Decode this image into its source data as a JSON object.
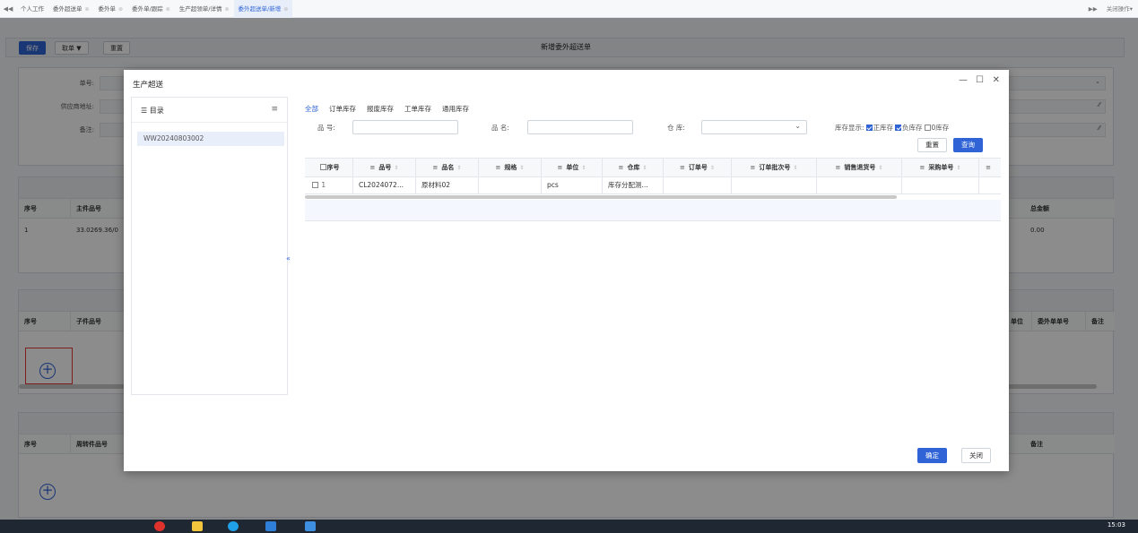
{
  "tabs": {
    "items": [
      "个人工作",
      "委外超送单",
      "委外单",
      "委外单/跟踪",
      "生产超领单/详情",
      "委外超送单/新增"
    ],
    "active_index": 5,
    "close_all_label": "关闭操作"
  },
  "toolbar": {
    "save_label": "保存",
    "fetch_label": "取单 ▼",
    "reset_label": "重置",
    "page_title": "新增委外超送单"
  },
  "form": {
    "order_no_label": "单号:",
    "supplier_address_label": "供应商地址:",
    "remark_label": "备注:"
  },
  "main_table": {
    "headers": [
      "序号",
      "主件品号",
      "总金额"
    ],
    "row": {
      "index": "1",
      "item_no": "33.0269.36/0",
      "amount": "0.00"
    }
  },
  "sub_table": {
    "headers": [
      "序号",
      "子件品号",
      "单位",
      "委外单单号",
      "备注"
    ]
  },
  "bottom_table": {
    "headers": [
      "序号",
      "周转件品号",
      "备注"
    ]
  },
  "taskbar": {
    "time": "15:03"
  },
  "dialog": {
    "title": "生产超送",
    "tree_title": "目录",
    "tree_item": "WW20240803002",
    "tabs": [
      "全部",
      "订单库存",
      "报废库存",
      "工单库存",
      "通用库存"
    ],
    "active_tab": 0,
    "search": {
      "item_no_label": "品 号:",
      "item_name_label": "品 名:",
      "warehouse_label": "仓 库:",
      "stock_display_label": "库存显示:",
      "positive_label": "正库存",
      "negative_label": "负库存",
      "zero_label": "0库存",
      "positive_checked": true,
      "negative_checked": true,
      "zero_checked": false,
      "reset_label": "重置",
      "query_label": "查询"
    },
    "grid": {
      "headers": [
        "序号",
        "品号",
        "品名",
        "规格",
        "单位",
        "仓库",
        "订单号",
        "订单批次号",
        "销售退货号",
        "采购单号"
      ],
      "rows": [
        {
          "index": "1",
          "item_no": "CL2024072...",
          "item_name": "原材料02",
          "spec": "",
          "unit": "pcs",
          "warehouse": "库存分配测...",
          "order_no": "",
          "batch_no": "",
          "return_no": "",
          "po_no": ""
        }
      ]
    },
    "confirm_label": "确定",
    "close_label": "关闭"
  }
}
